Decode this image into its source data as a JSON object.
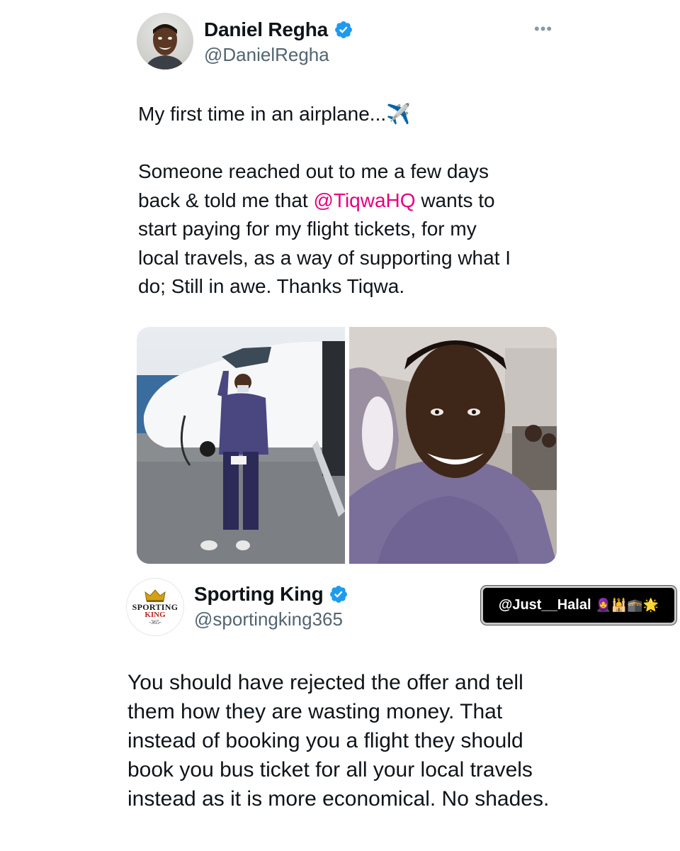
{
  "tweet1": {
    "author": {
      "name": "Daniel Regha",
      "handle": "@DanielRegha",
      "verified": true
    },
    "more_label": "•••",
    "text_line1": "My first time in an airplane...✈️",
    "text_p2_before": "Someone reached out to me a few days\nback & told me that ",
    "mention": "@TiqwaHQ",
    "text_p2_after": " wants to\nstart paying for my flight tickets, for my\nlocal travels, as a way of supporting what I\ndo; Still in awe. Thanks Tiqwa."
  },
  "tweet2": {
    "author": {
      "name": "Sporting King",
      "handle": "@sportingking365",
      "verified": true
    },
    "logo": {
      "line1": "SPORTING",
      "line2": "KING",
      "line3": "-365-"
    },
    "text": "You should have rejected the offer and tell them how they are wasting money. That instead of booking you a flight they should book you bus ticket for all your local travels instead as it is more economical. No shades."
  },
  "watermark": {
    "text": "@Just__Halal",
    "emojis": "🧕🕌🕋🌟"
  },
  "colors": {
    "mention": "#e6007e",
    "verified": "#1d9bf0",
    "secondary_text": "#536471"
  }
}
